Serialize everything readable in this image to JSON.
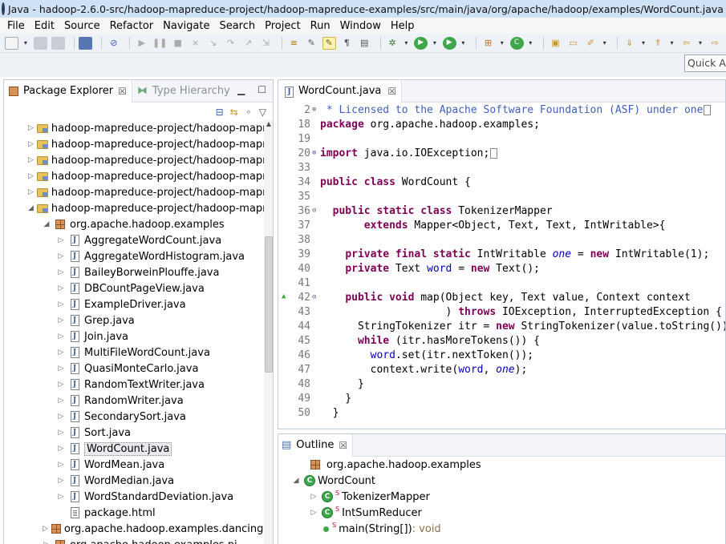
{
  "window": {
    "title": "Java - hadoop-2.6.0-src/hadoop-mapreduce-project/hadoop-mapreduce-examples/src/main/java/org/apache/hadoop/examples/WordCount.java - Eclip"
  },
  "menu": [
    "File",
    "Edit",
    "Source",
    "Refactor",
    "Navigate",
    "Search",
    "Project",
    "Run",
    "Window",
    "Help"
  ],
  "quick_access": {
    "placeholder": "Quick Ac"
  },
  "package_explorer": {
    "tab_label": "Package Explorer",
    "hierarchy_tab_label": "Type Hierarchy",
    "tree": [
      {
        "label": "hadoop-mapreduce-project/hadoop-mapre",
        "type": "folder",
        "indent": 0,
        "toggle": "▷"
      },
      {
        "label": "hadoop-mapreduce-project/hadoop-mapre",
        "type": "folder",
        "indent": 0,
        "toggle": "▷"
      },
      {
        "label": "hadoop-mapreduce-project/hadoop-mapre",
        "type": "folder",
        "indent": 0,
        "toggle": "▷"
      },
      {
        "label": "hadoop-mapreduce-project/hadoop-mapre",
        "type": "folder",
        "indent": 0,
        "toggle": "▷"
      },
      {
        "label": "hadoop-mapreduce-project/hadoop-mapre",
        "type": "folder",
        "indent": 0,
        "toggle": "▷"
      },
      {
        "label": "hadoop-mapreduce-project/hadoop-mapre",
        "type": "folder",
        "indent": 0,
        "toggle": "◢"
      },
      {
        "label": "org.apache.hadoop.examples",
        "type": "package",
        "indent": 1,
        "toggle": "◢"
      },
      {
        "label": "AggregateWordCount.java",
        "type": "java",
        "indent": 2,
        "toggle": "▷"
      },
      {
        "label": "AggregateWordHistogram.java",
        "type": "java",
        "indent": 2,
        "toggle": "▷"
      },
      {
        "label": "BaileyBorweinPlouffe.java",
        "type": "java",
        "indent": 2,
        "toggle": "▷"
      },
      {
        "label": "DBCountPageView.java",
        "type": "java",
        "indent": 2,
        "toggle": "▷"
      },
      {
        "label": "ExampleDriver.java",
        "type": "java",
        "indent": 2,
        "toggle": "▷"
      },
      {
        "label": "Grep.java",
        "type": "java",
        "indent": 2,
        "toggle": "▷"
      },
      {
        "label": "Join.java",
        "type": "java",
        "indent": 2,
        "toggle": "▷"
      },
      {
        "label": "MultiFileWordCount.java",
        "type": "java",
        "indent": 2,
        "toggle": "▷"
      },
      {
        "label": "QuasiMonteCarlo.java",
        "type": "java",
        "indent": 2,
        "toggle": "▷"
      },
      {
        "label": "RandomTextWriter.java",
        "type": "java",
        "indent": 2,
        "toggle": "▷"
      },
      {
        "label": "RandomWriter.java",
        "type": "java",
        "indent": 2,
        "toggle": "▷"
      },
      {
        "label": "SecondarySort.java",
        "type": "java",
        "indent": 2,
        "toggle": "▷"
      },
      {
        "label": "Sort.java",
        "type": "java",
        "indent": 2,
        "toggle": "▷"
      },
      {
        "label": "WordCount.java",
        "type": "java",
        "indent": 2,
        "toggle": "▷",
        "selected": true
      },
      {
        "label": "WordMean.java",
        "type": "java",
        "indent": 2,
        "toggle": "▷"
      },
      {
        "label": "WordMedian.java",
        "type": "java",
        "indent": 2,
        "toggle": "▷"
      },
      {
        "label": "WordStandardDeviation.java",
        "type": "java",
        "indent": 2,
        "toggle": "▷"
      },
      {
        "label": "package.html",
        "type": "html",
        "indent": 2,
        "toggle": ""
      },
      {
        "label": "org.apache.hadoop.examples.dancing",
        "type": "package",
        "indent": 1,
        "toggle": "▷"
      },
      {
        "label": "org.apache.hadoop.examples.pi",
        "type": "package",
        "indent": 1,
        "toggle": "▷"
      }
    ]
  },
  "editor": {
    "tab_label": "WordCount.java",
    "lines": [
      {
        "n": "2",
        "fold": "⊕",
        "parts": [
          [
            "cm",
            " * Licensed to the Apache Software Foundation (ASF) under one"
          ]
        ],
        "box": true
      },
      {
        "n": "18",
        "fold": "",
        "parts": [
          [
            "kw",
            "package"
          ],
          [
            "",
            " org.apache.hadoop.examples;"
          ]
        ]
      },
      {
        "n": "19",
        "fold": "",
        "parts": []
      },
      {
        "n": "20",
        "fold": "⊕",
        "parts": [
          [
            "kw",
            "import"
          ],
          [
            "",
            " java.io.IOException;"
          ]
        ],
        "box": true
      },
      {
        "n": "33",
        "fold": "",
        "parts": []
      },
      {
        "n": "34",
        "fold": "",
        "parts": [
          [
            "kw",
            "public class"
          ],
          [
            "",
            " WordCount {"
          ]
        ]
      },
      {
        "n": "35",
        "fold": "",
        "parts": []
      },
      {
        "n": "36",
        "fold": "⊖",
        "parts": [
          [
            "",
            "  "
          ],
          [
            "kw",
            "public static class"
          ],
          [
            "",
            " TokenizerMapper"
          ]
        ]
      },
      {
        "n": "37",
        "fold": "",
        "parts": [
          [
            "",
            "       "
          ],
          [
            "kw",
            "extends"
          ],
          [
            "",
            " Mapper<Object, Text, Text, IntWritable>{"
          ]
        ]
      },
      {
        "n": "38",
        "fold": "",
        "parts": []
      },
      {
        "n": "39",
        "fold": "",
        "parts": [
          [
            "",
            "    "
          ],
          [
            "kw",
            "private final static"
          ],
          [
            "",
            " IntWritable "
          ],
          [
            "fis",
            "one"
          ],
          [
            "",
            " = "
          ],
          [
            "kw",
            "new"
          ],
          [
            "",
            " IntWritable(1);"
          ]
        ]
      },
      {
        "n": "40",
        "fold": "",
        "parts": [
          [
            "",
            "    "
          ],
          [
            "kw",
            "private"
          ],
          [
            "",
            " Text "
          ],
          [
            "fi",
            "word"
          ],
          [
            "",
            " = "
          ],
          [
            "kw",
            "new"
          ],
          [
            "",
            " Text();"
          ]
        ]
      },
      {
        "n": "41",
        "fold": "",
        "parts": []
      },
      {
        "n": "42",
        "fold": "⊖",
        "parts": [
          [
            "",
            "    "
          ],
          [
            "kw",
            "public void"
          ],
          [
            "",
            " map(Object key, Text value, Context context"
          ]
        ],
        "override": true
      },
      {
        "n": "43",
        "fold": "",
        "parts": [
          [
            "",
            "                    ) "
          ],
          [
            "kw",
            "throws"
          ],
          [
            "",
            " IOException, InterruptedException {"
          ]
        ]
      },
      {
        "n": "44",
        "fold": "",
        "parts": [
          [
            "",
            "      StringTokenizer itr = "
          ],
          [
            "kw",
            "new"
          ],
          [
            "",
            " StringTokenizer(value.toString());"
          ]
        ]
      },
      {
        "n": "45",
        "fold": "",
        "parts": [
          [
            "",
            "      "
          ],
          [
            "kw",
            "while"
          ],
          [
            "",
            " (itr.hasMoreTokens()) {"
          ]
        ]
      },
      {
        "n": "46",
        "fold": "",
        "parts": [
          [
            "",
            "        "
          ],
          [
            "fi",
            "word"
          ],
          [
            "",
            ".set(itr.nextToken());"
          ]
        ]
      },
      {
        "n": "47",
        "fold": "",
        "parts": [
          [
            "",
            "        context.write("
          ],
          [
            "fi",
            "word"
          ],
          [
            "",
            ", "
          ],
          [
            "fis",
            "one"
          ],
          [
            "",
            ");"
          ]
        ]
      },
      {
        "n": "48",
        "fold": "",
        "parts": [
          [
            "",
            "      }"
          ]
        ]
      },
      {
        "n": "49",
        "fold": "",
        "parts": [
          [
            "",
            "    }"
          ]
        ]
      },
      {
        "n": "50",
        "fold": "",
        "parts": [
          [
            "",
            "  }"
          ]
        ]
      }
    ]
  },
  "outline": {
    "tab_label": "Outline",
    "items": [
      {
        "label": "org.apache.hadoop.examples",
        "kind": "package",
        "toggle": ""
      },
      {
        "label": "WordCount",
        "kind": "class",
        "toggle": "◢"
      },
      {
        "label": "TokenizerMapper",
        "kind": "nested-class",
        "toggle": "▷",
        "sup": "S"
      },
      {
        "label": "IntSumReducer",
        "kind": "nested-class",
        "toggle": "▷",
        "sup": "S"
      },
      {
        "label": "main(String[])",
        "ret": " : void",
        "kind": "method",
        "toggle": "",
        "sup": "S"
      }
    ]
  },
  "colors": {
    "keyword": "#7f0055",
    "comment": "#3f5fbf",
    "field": "#0000c0"
  }
}
